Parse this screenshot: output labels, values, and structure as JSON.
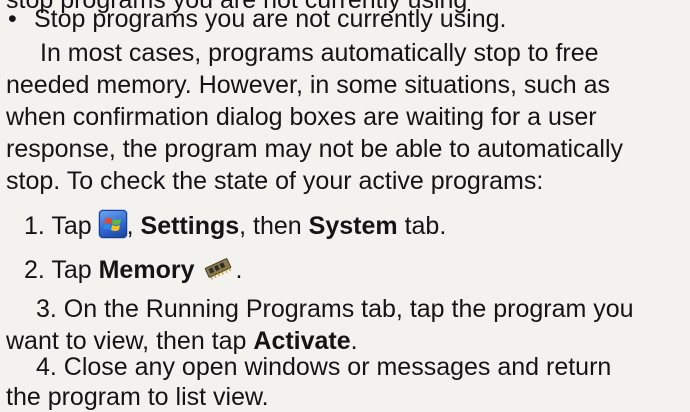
{
  "top_cut_text": "stop programs you are not currently using",
  "bullet": {
    "symbol": "•",
    "text": "Stop programs you are not currently using."
  },
  "paragraph": {
    "line1": "In most cases, programs automatically stop to free",
    "line2": "needed memory. However, in some situations, such as",
    "line3": "when confirmation dialog boxes are waiting for a user",
    "line4": "response, the program may not be able to automatically",
    "line5": "stop. To check the state of your active programs:"
  },
  "steps": {
    "step1": {
      "prefix": "1. Tap",
      "icon": "windows-start-icon",
      "sep1": ",",
      "bold1": "Settings",
      "mid": ", then",
      "bold2": "System",
      "suffix": "tab."
    },
    "step2": {
      "prefix": "2. Tap",
      "bold": "Memory",
      "icon": "memory-chip-icon",
      "suffix": "."
    },
    "step3": {
      "line1": "3. On the Running Programs tab, tap the program you",
      "line2_prefix": "want to view, then tap",
      "line2_bold": "Activate",
      "line2_suffix": "."
    },
    "step4": {
      "line1": "4. Close any open windows or messages and return",
      "line2": "the program to list view."
    }
  },
  "colors": {
    "text": "#141414",
    "background": "#f4f2ee",
    "start_icon": "#2f64cf"
  }
}
